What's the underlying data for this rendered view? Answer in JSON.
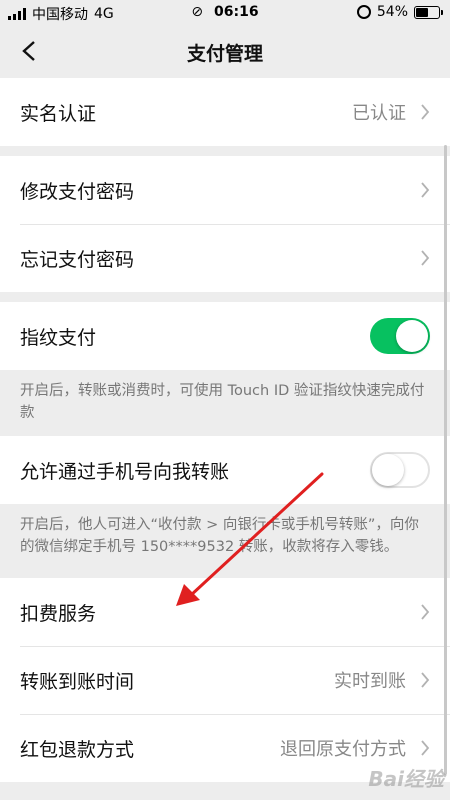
{
  "status_bar": {
    "carrier": "中国移动",
    "network": "4G",
    "time": "06:16",
    "battery": "54%",
    "battery_level": 0.54
  },
  "nav": {
    "title": "支付管理"
  },
  "rows": {
    "realname": {
      "label": "实名认证",
      "value": "已认证"
    },
    "change_password": {
      "label": "修改支付密码"
    },
    "forgot_password": {
      "label": "忘记支付密码"
    },
    "fingerprint": {
      "label": "指纹支付",
      "enabled": true,
      "desc": "开启后，转账或消费时，可使用 Touch ID 验证指纹快速完成付款"
    },
    "phone_transfer": {
      "label": "允许通过手机号向我转账",
      "enabled": false,
      "desc": "开启后，他人可进入“收付款 > 向银行卡或手机号转账”，向你的微信绑定手机号 150****9532 转账，收款将存入零钱。"
    },
    "deduction": {
      "label": "扣费服务"
    },
    "arrival_time": {
      "label": "转账到账时间",
      "value": "实时到账"
    },
    "red_packet_refund": {
      "label": "红包退款方式",
      "value": "退回原支付方式"
    }
  },
  "colors": {
    "accent_green": "#07c160",
    "annotation_red": "#e02020",
    "background": "#ededed"
  },
  "icons": [
    "back-arrow-icon",
    "chevron-right-icon",
    "signal-icon",
    "link-icon",
    "lock-rotation-icon",
    "battery-icon"
  ],
  "watermark": "Bai经验"
}
